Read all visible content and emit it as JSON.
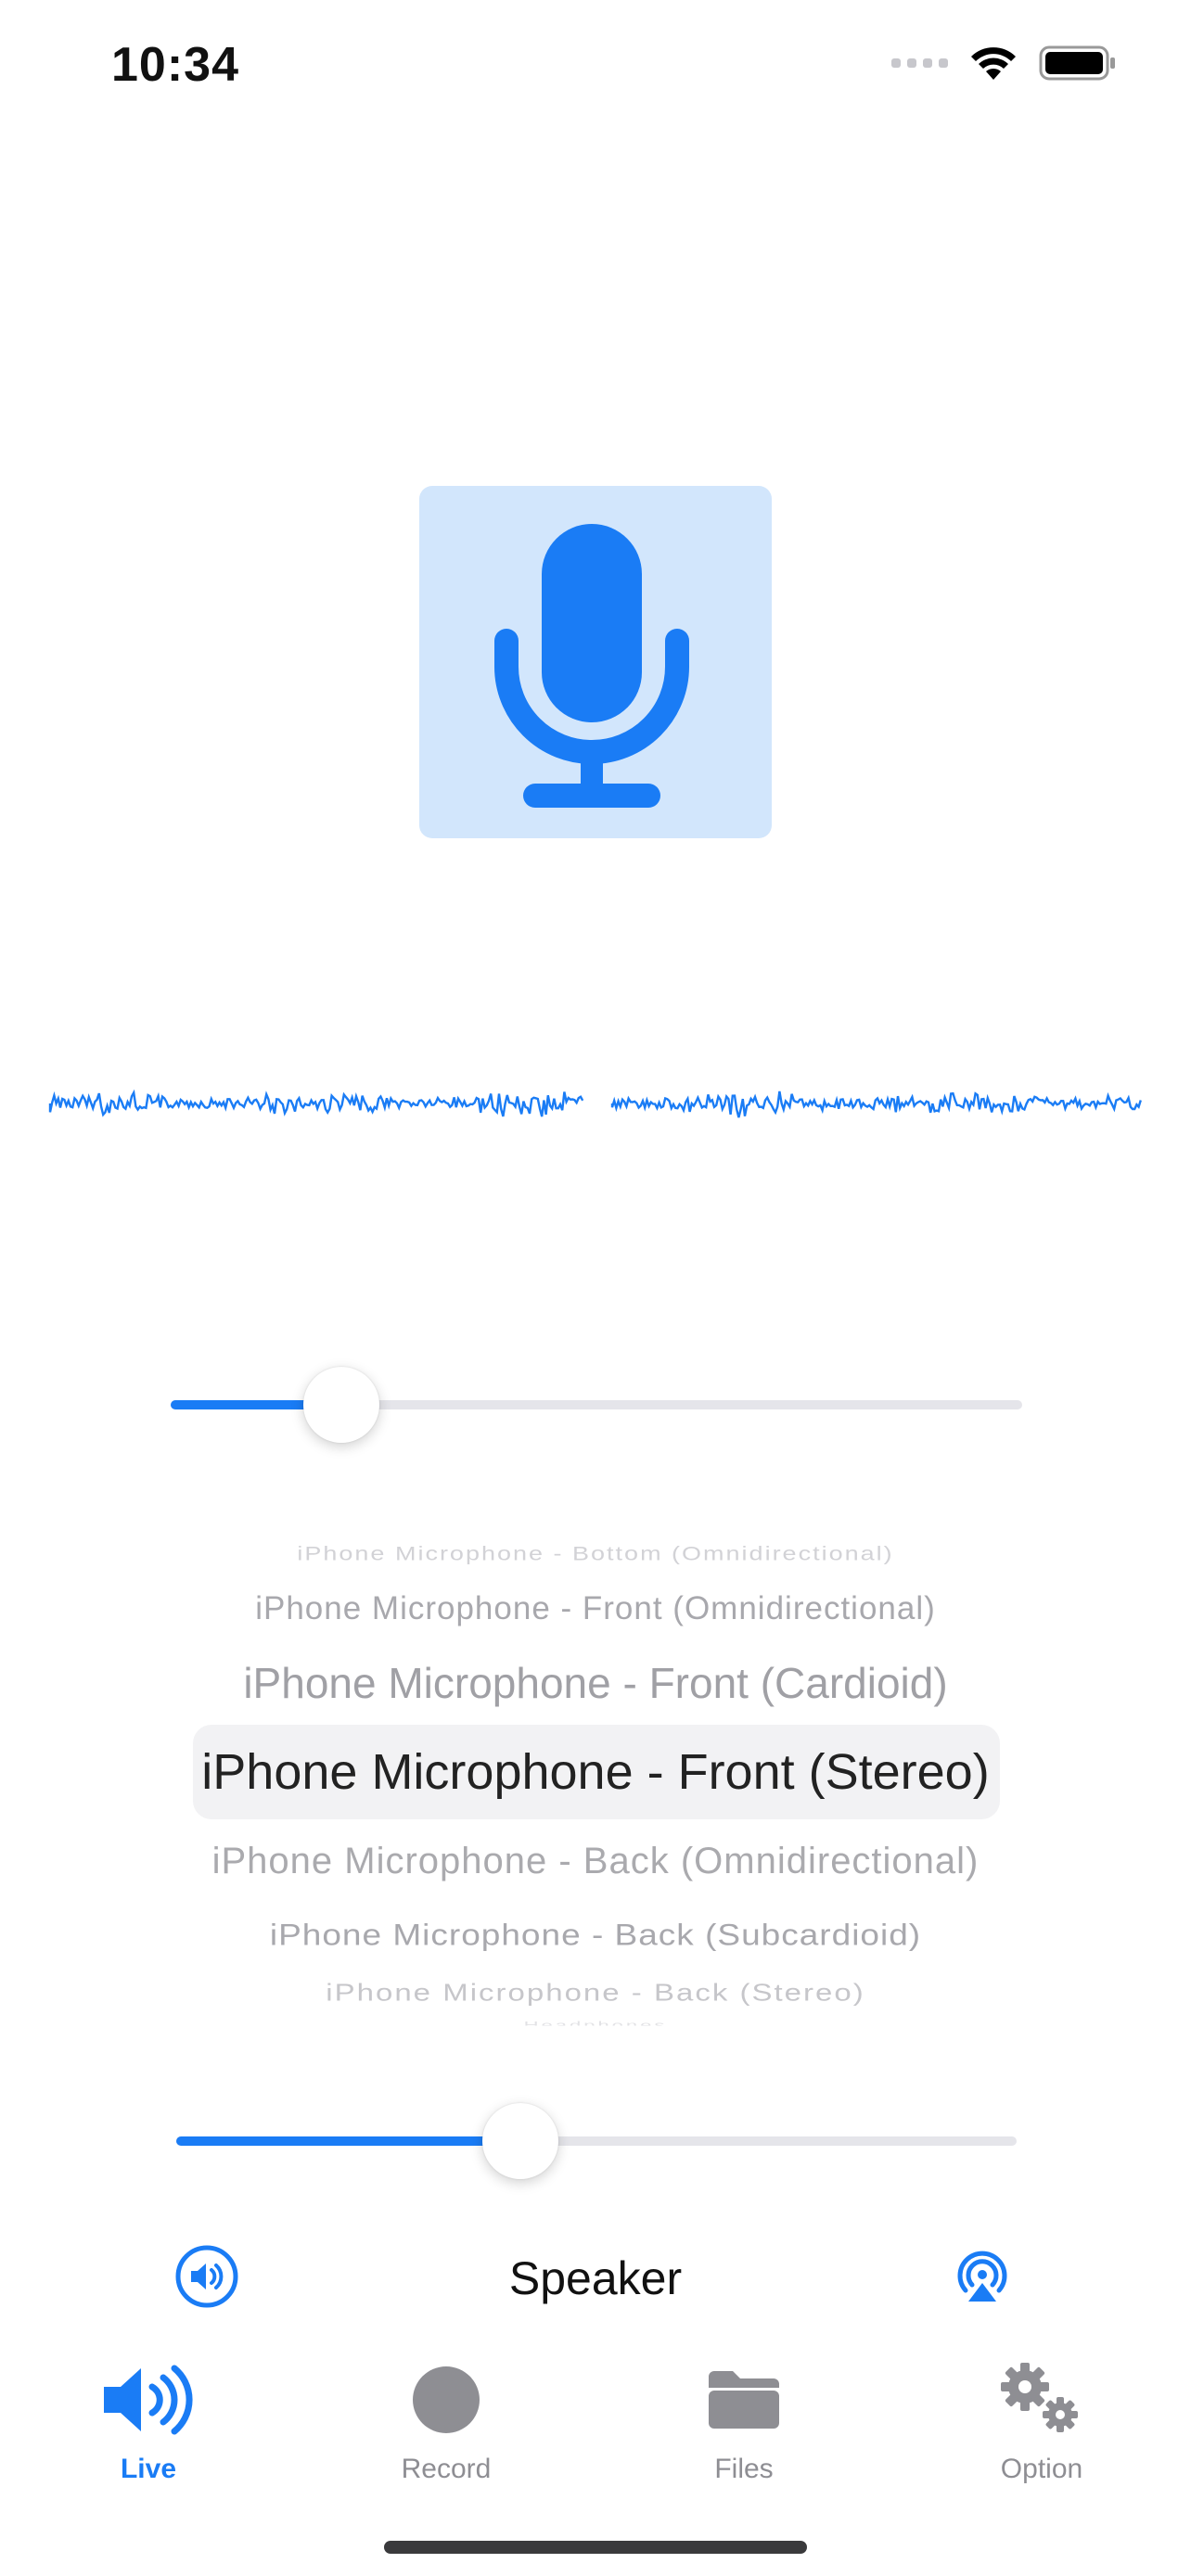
{
  "status_bar": {
    "time": "10:34"
  },
  "colors": {
    "accent": "#1a7cf5",
    "mic_tile_background": "#d2e6fc",
    "tab_inactive": "#8e8e93"
  },
  "icons": {
    "mic": "microphone-icon",
    "volume": "speaker-volume-icon",
    "airplay": "airplay-icon"
  },
  "gain_slider": {
    "value": 0.2
  },
  "volume_slider": {
    "value": 0.41
  },
  "mic_picker": {
    "selected_index": 3,
    "options": [
      "iPhone Microphone - Bottom (Omnidirectional)",
      "iPhone Microphone - Front (Omnidirectional)",
      "iPhone Microphone - Front (Cardioid)",
      "iPhone Microphone - Front (Stereo)",
      "iPhone Microphone - Back (Omnidirectional)",
      "iPhone Microphone - Back (Subcardioid)",
      "iPhone Microphone - Back (Stereo)",
      "Headphones"
    ]
  },
  "output": {
    "label": "Speaker"
  },
  "tabs": [
    {
      "label": "Live",
      "icon": "speaker-wave-icon",
      "active": true
    },
    {
      "label": "Record",
      "icon": "record-circle-icon",
      "active": false
    },
    {
      "label": "Files",
      "icon": "folder-icon",
      "active": false
    },
    {
      "label": "Option",
      "icon": "gears-icon",
      "active": false
    }
  ]
}
